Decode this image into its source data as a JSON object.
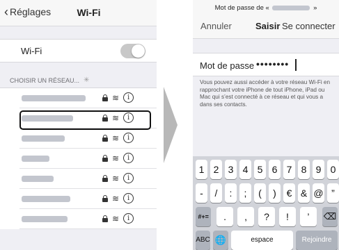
{
  "left_screen": {
    "back_label": "Réglages",
    "title": "Wi-Fi",
    "wifi_label": "Wi-Fi",
    "wifi_on": false,
    "section_header": "CHOISIR UN RÉSEAU...",
    "networks": [
      {
        "name_hidden": true,
        "secure": true
      },
      {
        "name_hidden": true,
        "secure": true,
        "highlighted": true
      },
      {
        "name_hidden": true,
        "secure": true
      },
      {
        "name_hidden": true,
        "secure": true
      },
      {
        "name_hidden": true,
        "secure": true
      },
      {
        "name_hidden": true,
        "secure": true
      },
      {
        "name_hidden": true,
        "secure": true
      }
    ]
  },
  "right_screen": {
    "prompt_prefix": "Mot de passe de «",
    "prompt_suffix": "»",
    "cancel_label": "Annuler",
    "title": "Saisir",
    "join_label": "Se connecter",
    "password_label": "Mot de passe",
    "password_value": "••••••••",
    "note": "Vous pouvez aussi accéder à votre réseau Wi-Fi en rapprochant votre iPhone de tout iPhone, iPad ou Mac qui s’est connecté à ce réseau et qui vous a dans ses contacts.",
    "keyboard": {
      "row1": [
        "1",
        "2",
        "3",
        "4",
        "5",
        "6",
        "7",
        "8",
        "9",
        "0"
      ],
      "row2": [
        "-",
        "/",
        ":",
        ";",
        "(",
        ")",
        "€",
        "&",
        "@",
        "”"
      ],
      "row3_mode": "#+=",
      "row3": [
        ".",
        ",",
        "?",
        "!",
        "’"
      ],
      "row4_abc": "ABC",
      "row4_space": "espace",
      "row4_join": "Rejoindre"
    }
  },
  "colors": {
    "background": "#efeff4",
    "keyboard_bg": "#d1d3d9",
    "highlight_border": "#111111"
  }
}
